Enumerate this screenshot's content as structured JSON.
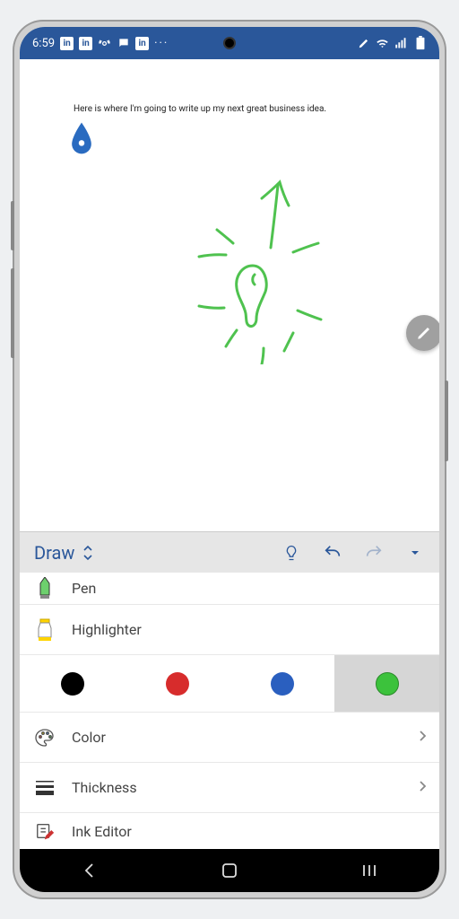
{
  "statusbar": {
    "time": "6:59"
  },
  "document": {
    "text": "Here is where I'm going to write up my next great business idea."
  },
  "toolbar": {
    "mode_label": "Draw"
  },
  "list": {
    "pen_label": "Pen",
    "highlighter_label": "Highlighter",
    "color_label": "Color",
    "thickness_label": "Thickness",
    "ink_editor_label": "Ink Editor"
  },
  "swatches": {
    "colors": [
      "#000000",
      "#d72c2c",
      "#2a5fbf",
      "#3cc23c"
    ],
    "selected_index": 3
  }
}
